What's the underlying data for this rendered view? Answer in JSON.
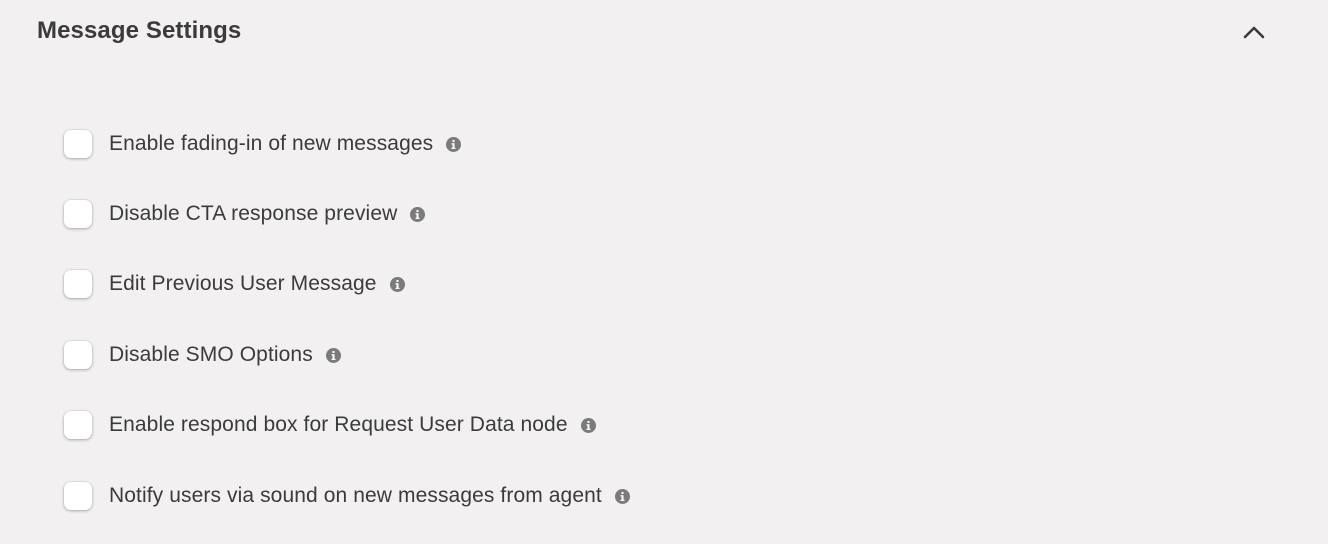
{
  "header": {
    "title": "Message Settings",
    "toggle_icon": "chevron-up-icon"
  },
  "settings": [
    {
      "label": "Enable fading-in of new messages",
      "checked": false,
      "info_icon": "info-icon"
    },
    {
      "label": "Disable CTA response preview",
      "checked": false,
      "info_icon": "info-icon"
    },
    {
      "label": "Edit Previous User Message",
      "checked": false,
      "info_icon": "info-icon"
    },
    {
      "label": "Disable SMO Options",
      "checked": false,
      "info_icon": "info-icon"
    },
    {
      "label": "Enable respond box for Request User Data node",
      "checked": false,
      "info_icon": "info-icon"
    },
    {
      "label": "Notify users via sound on new messages from agent",
      "checked": false,
      "info_icon": "info-icon"
    }
  ],
  "colors": {
    "background": "#f2f0f1",
    "text": "#3b3b3b",
    "icon": "#7b7b7b",
    "checkbox": "#ffffff"
  }
}
